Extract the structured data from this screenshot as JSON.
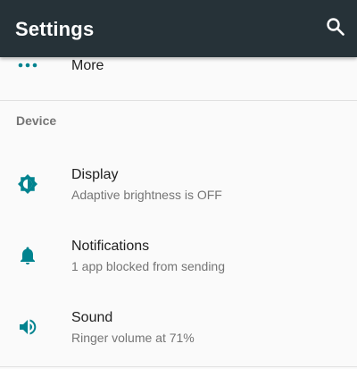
{
  "appbar": {
    "title": "Settings",
    "search_icon": "search-icon"
  },
  "more_row": {
    "label": "More",
    "icon": "more-horiz-icon"
  },
  "device_section": {
    "header": "Device",
    "items": [
      {
        "title": "Display",
        "summary": "Adaptive brightness is OFF",
        "icon": "brightness-icon"
      },
      {
        "title": "Notifications",
        "summary": "1 app blocked from sending",
        "icon": "bell-icon"
      },
      {
        "title": "Sound",
        "summary": "Ringer volume at 71%",
        "icon": "volume-icon"
      }
    ]
  },
  "colors": {
    "appbar": "#263238",
    "accent": "#00838f",
    "background": "#fafafa"
  }
}
